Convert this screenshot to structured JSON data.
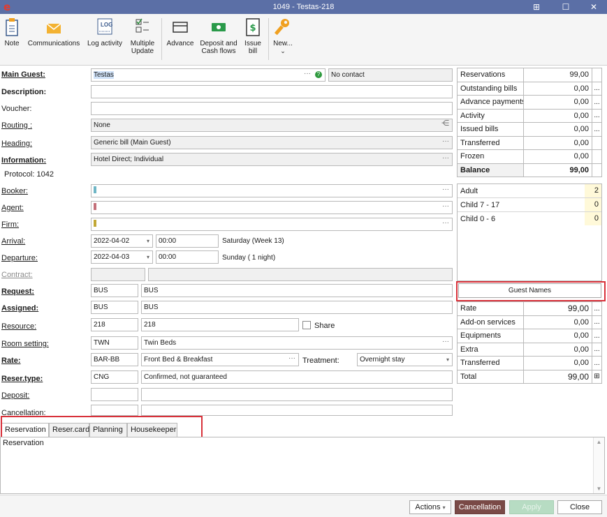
{
  "window": {
    "logo": "e",
    "title": "1049 - Testas-218"
  },
  "ribbon": {
    "note": "Note",
    "communications": "Communications",
    "log_activity": "Log activity",
    "log_icon_text": "LOG",
    "multiple_update_1": "Multiple",
    "multiple_update_2": "Update",
    "advance": "Advance",
    "deposit_1": "Deposit and",
    "deposit_2": "Cash flows",
    "issue_1": "Issue",
    "issue_2": "bill",
    "new": "New...",
    "new_caret": "⌄"
  },
  "form": {
    "main_guest": {
      "label": "Main Guest:",
      "value": "Testas",
      "contact": "No contact"
    },
    "description": {
      "label": "Description:",
      "value": ""
    },
    "voucher": {
      "label": "Voucher:",
      "value": ""
    },
    "routing": {
      "label": "Routing :",
      "value": "None"
    },
    "heading": {
      "label": "Heading:",
      "value": "Generic bill (Main Guest)"
    },
    "information": {
      "label": "Information:",
      "value": "Hotel Direct; Individual"
    },
    "protocol": "Protocol: 1042",
    "booker": {
      "label": "Booker:",
      "color": "#6fb6c6"
    },
    "agent": {
      "label": "Agent:",
      "color": "#c4707a"
    },
    "firm": {
      "label": "Firm:",
      "color": "#c2a836"
    },
    "arrival": {
      "label": "Arrival:",
      "date": "2022-04-02",
      "time": "00:00",
      "info": "Saturday (Week 13)"
    },
    "departure": {
      "label": "Departure:",
      "date": "2022-04-03",
      "time": "00:00",
      "info": "Sunday ( 1 night)"
    },
    "contract": {
      "label": "Contract:"
    },
    "request": {
      "label": "Request:",
      "code": "BUS",
      "name": "BUS"
    },
    "assigned": {
      "label": "Assigned:",
      "code": "BUS",
      "name": "BUS"
    },
    "resource": {
      "label": "Resource:",
      "code": "218",
      "name": "218",
      "share": "Share"
    },
    "room_setting": {
      "label": "Room setting:",
      "code": "TWN",
      "name": "Twin Beds"
    },
    "rate": {
      "label": "Rate:",
      "code": "BAR-BB",
      "name": "Front Bed & Breakfast",
      "treatment_label": "Treatment:",
      "treatment": "Overnight stay"
    },
    "reser_type": {
      "label": "Reser.type:",
      "code": "CNG",
      "name": "Confirmed, not guaranteed"
    },
    "deposit": {
      "label": "Deposit:"
    },
    "cancellation": {
      "label": "Cancellation:"
    }
  },
  "summary": [
    {
      "label": "Reservations",
      "value": "99,00",
      "more": ""
    },
    {
      "label": "Outstanding bills",
      "value": "0,00",
      "more": "..."
    },
    {
      "label": "Advance payments",
      "value": "0,00",
      "more": "..."
    },
    {
      "label": "Activity",
      "value": "0,00",
      "more": "..."
    },
    {
      "label": "Issued bills",
      "value": "0,00",
      "more": "..."
    },
    {
      "label": "Transferred",
      "value": "0,00",
      "more": ""
    },
    {
      "label": "Frozen",
      "value": "0,00",
      "more": ""
    },
    {
      "label": "Balance",
      "value": "99,00",
      "more": ""
    }
  ],
  "guests": [
    {
      "label": "Adult",
      "value": "2"
    },
    {
      "label": "Child 7 - 17",
      "value": "0"
    },
    {
      "label": "Child 0 - 6",
      "value": "0"
    }
  ],
  "guest_names_button": "Guest Names",
  "charges": [
    {
      "label": "Rate",
      "value": "99,00",
      "more": "..."
    },
    {
      "label": "Add-on services",
      "value": "0,00",
      "more": "..."
    },
    {
      "label": "Equipments",
      "value": "0,00",
      "more": "..."
    },
    {
      "label": "Extra",
      "value": "0,00",
      "more": "..."
    },
    {
      "label": "Transferred",
      "value": "0,00",
      "more": "..."
    },
    {
      "label": "Total",
      "value": "99,00",
      "more": "⊞"
    }
  ],
  "tabs": [
    "Reservation",
    "Reser.card",
    "Planning",
    "Housekeeper"
  ],
  "notes_text": "Reservation",
  "footer": {
    "actions": "Actions",
    "cancellation": "Cancellation",
    "apply": "Apply",
    "close": "Close"
  },
  "colors": {
    "titlebar": "#5b6fa6",
    "cancel_button": "#7a4a47",
    "apply_button": "#b7dcc3",
    "highlight": "#d8313a"
  }
}
